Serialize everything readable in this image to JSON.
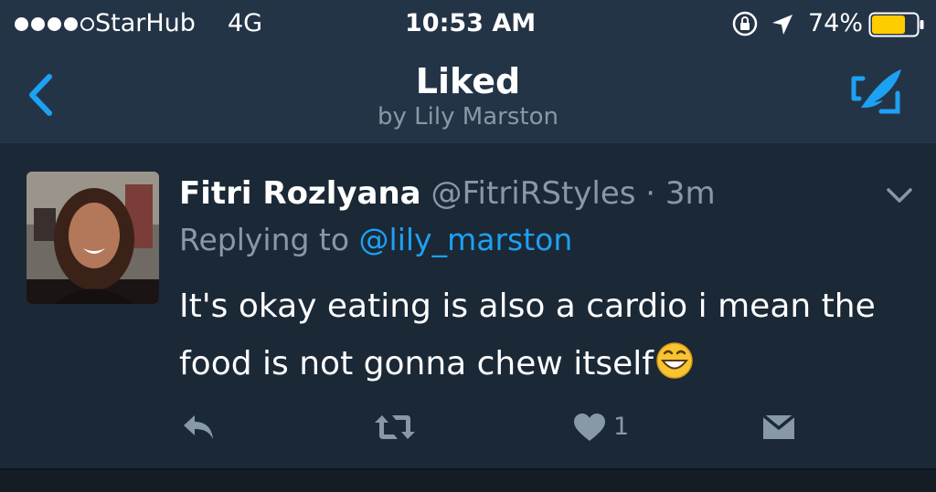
{
  "status_bar": {
    "carrier": "StarHub",
    "network": "4G",
    "time": "10:53 AM",
    "battery_percent": "74%",
    "battery_level": 0.74,
    "signal_bars": 4,
    "icons": [
      "signal-icon",
      "lock-icon",
      "location-icon",
      "battery-icon"
    ]
  },
  "nav": {
    "title": "Liked",
    "subtitle": "by Lily Marston",
    "back_icon": "chevron-left-icon",
    "compose_icon": "compose-icon"
  },
  "tweet": {
    "display_name": "Fitri Rozlyana",
    "handle": "@FitriRStyles",
    "separator": "·",
    "time": "3m",
    "replying_prefix": "Replying to ",
    "replying_to": "@lily_marston",
    "text": "It's okay eating is also a cardio i mean the food is not gonna chew itself",
    "emoji": "grinning-face-icon",
    "menu_icon": "chevron-down-icon",
    "actions": {
      "reply_icon": "reply-icon",
      "retweet_icon": "retweet-icon",
      "like_icon": "heart-icon",
      "like_count": "1",
      "dm_icon": "direct-message-icon"
    }
  },
  "colors": {
    "header_bg": "#243447",
    "tweet_bg": "#1b2836",
    "accent": "#1da1f2",
    "muted": "#8899a6",
    "battery": "#ffcc00"
  }
}
